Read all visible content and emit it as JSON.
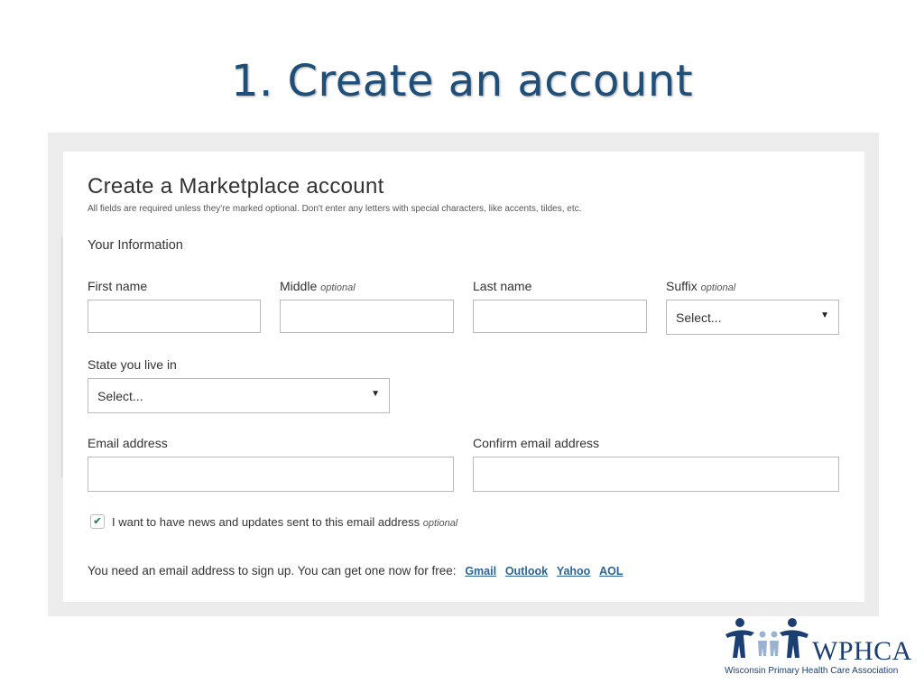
{
  "slide": {
    "title": "1. Create an account"
  },
  "form": {
    "title": "Create a Marketplace account",
    "subtitle": "All fields are required unless they're marked optional. Don't enter any letters with special characters, like accents, tildes, etc.",
    "section_heading": "Your Information",
    "first_name": {
      "label": "First name",
      "value": ""
    },
    "middle": {
      "label": "Middle",
      "optional": "optional",
      "value": ""
    },
    "last_name": {
      "label": "Last name",
      "value": ""
    },
    "suffix": {
      "label": "Suffix",
      "optional": "optional",
      "selected": "Select..."
    },
    "state": {
      "label": "State you live in",
      "selected": "Select..."
    },
    "email": {
      "label": "Email address",
      "value": ""
    },
    "confirm_email": {
      "label": "Confirm email address",
      "value": ""
    },
    "news_checkbox": {
      "label": "I want to have news and updates sent to this email address",
      "optional": "optional",
      "checked": true
    },
    "email_note": "You need an email address to sign up. You can get one now for free:",
    "email_providers": [
      "Gmail",
      "Outlook",
      "Yahoo",
      "AOL"
    ]
  },
  "logo": {
    "text": "WPHCA",
    "subtext": "Wisconsin Primary Health Care Association"
  },
  "colors": {
    "title": "#1f4e79",
    "link": "#2a6496",
    "check": "#2e8b57",
    "logo": "#1c3f73"
  },
  "icons": {
    "dropdown": "triangle-down",
    "checkbox": "checkmark"
  }
}
